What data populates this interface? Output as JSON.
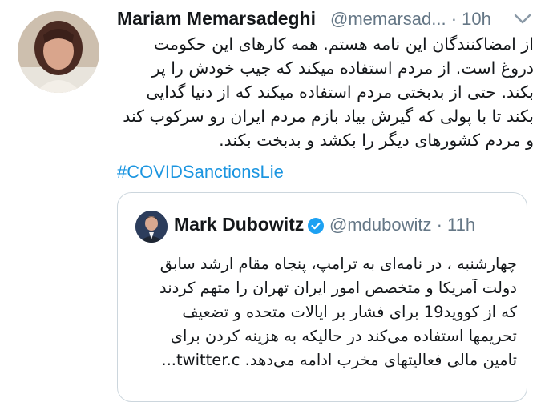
{
  "tweet": {
    "author_name": "Mariam Memarsadeghi",
    "author_handle_time": "@memarsad... · 10h",
    "text_lines": [
      "از امضاکنندگان این نامه هستم. همه کارهای این حکومت",
      "دروغ است. از مردم استفاده میکند که جیب خودش را پر",
      "بکند. حتی از بدبختی مردم استفاده میکند که از دنیا گدایی",
      "بکند تا با پولی که گیرش بیاد بازم مردم ایران رو سرکوب کند",
      "و مردم کشورهای دیگر را بکشد و بدبخت بکند."
    ],
    "hashtag": "#COVIDSanctionsLie",
    "avatar_icon": "profile-photo",
    "menu_icon": "chevron-down-icon"
  },
  "quoted_tweet": {
    "author_name": "Mark Dubowitz",
    "author_handle_time": "@mdubowitz · 11h",
    "verified_icon": "verified-badge-icon",
    "text_lines": [
      "چهارشنبه ، در نامه‌ای به ترامپ، پنجاه مقام ارشد سابق",
      "دولت آمریکا و متخصص امور ایران تهران را متهم کردند",
      "که از کووید19 برای فشار بر  ایالات متحده و تضعیف",
      "تحریمها استفاده می‌کند در حالیکه به هزینه کردن برای",
      "تامین مالی فعالیتهای مخرب ادامه می‌دهد. twitter.c..."
    ]
  },
  "colors": {
    "text": "#14171a",
    "muted": "#657786",
    "link": "#1b95e0",
    "border": "#ccd6dd",
    "verified": "#1da1f2"
  }
}
